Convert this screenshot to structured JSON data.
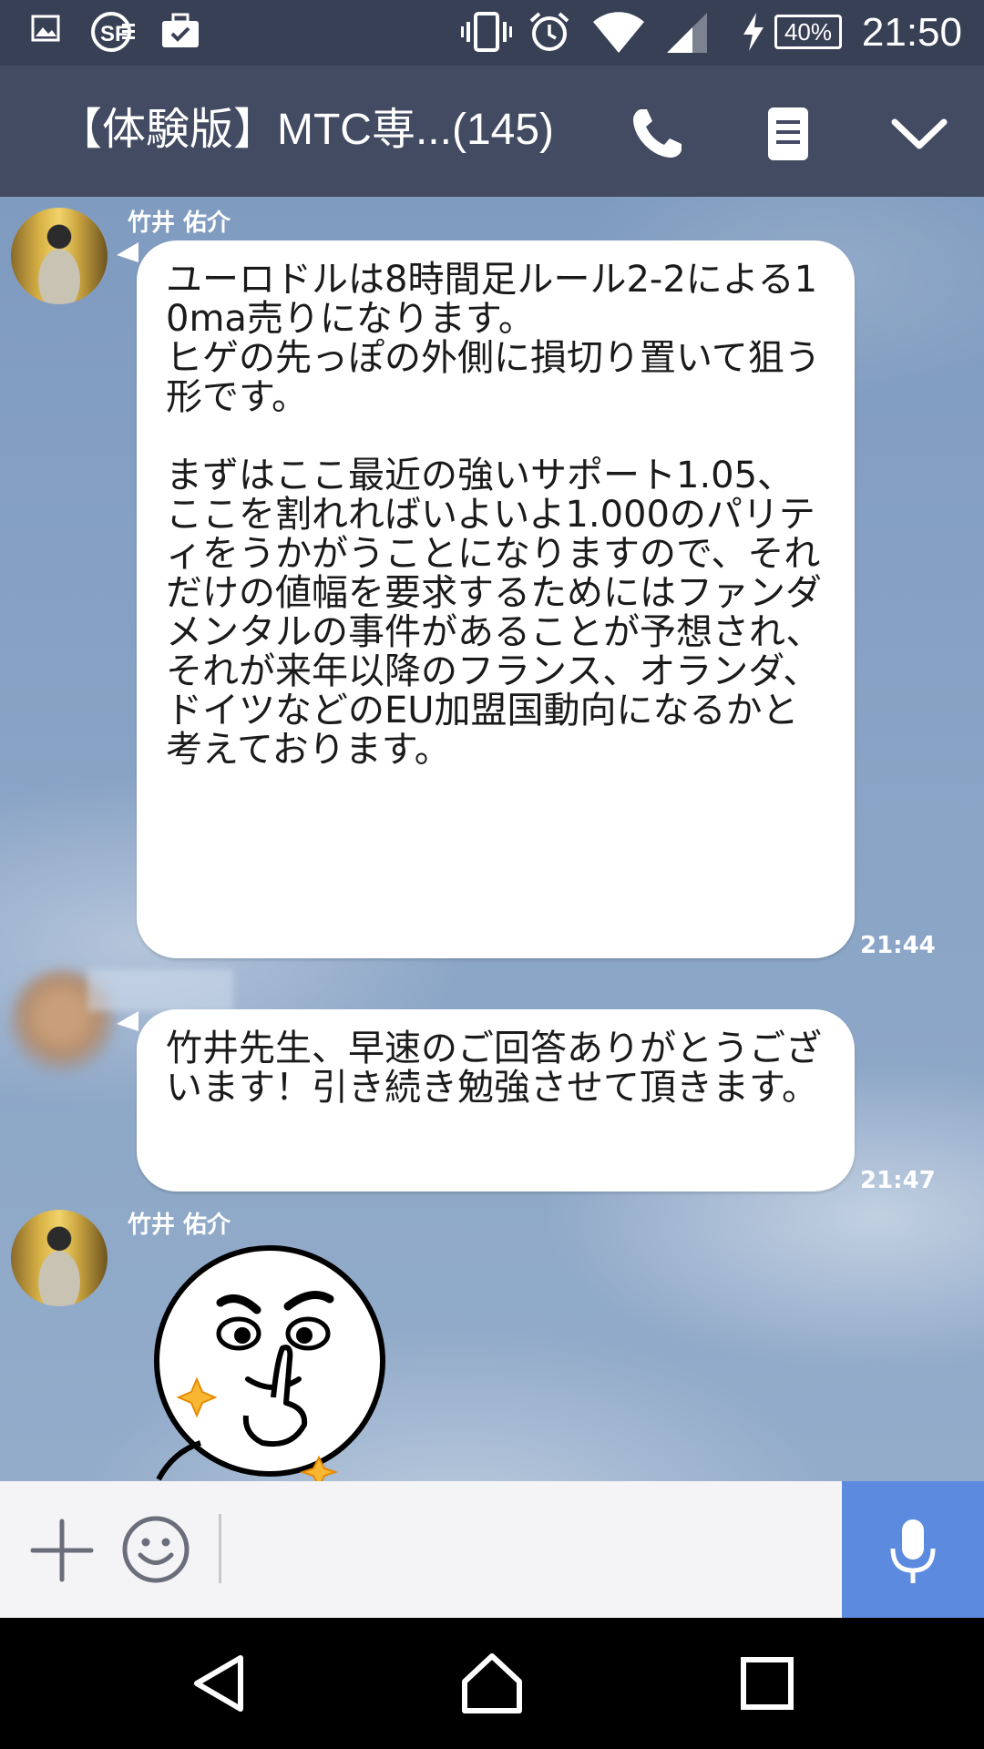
{
  "status_bar": {
    "time": "21:50",
    "battery": "40%",
    "icons": [
      "image-icon",
      "sf-app-icon",
      "briefcase-icon",
      "vibrate-icon",
      "alarm-icon",
      "wifi-icon",
      "signal-icon",
      "charging-icon",
      "battery-icon"
    ]
  },
  "header": {
    "title": "【体験版】MTC専...(145)",
    "icons": [
      "phone-icon",
      "note-icon",
      "chevron-down-icon"
    ]
  },
  "messages": [
    {
      "sender": "竹井 佑介",
      "text": "ユーロドルは8時間足ルール2-2による10ma売りになります。\nヒゲの先っぽの外側に損切り置いて狙う形です。\n\nまずはここ最近の強いサポート1.05、ここを割れればいよいよ1.000のパリティをうかがうことになりますので、それだけの値幅を要求するためにはファンダメンタルの事件があることが予想され、それが来年以降のフランス、オランダ、ドイツなどのEU加盟国動向になるかと考えております。",
      "time": "21:44"
    },
    {
      "sender": "",
      "text": "竹井先生、早速のご回答ありがとうございます！引き続き勉強させて頂きます。",
      "time": "21:47"
    },
    {
      "sender": "竹井 佑介",
      "type": "sticker"
    }
  ],
  "input_bar": {
    "icons": [
      "plus-icon",
      "emoji-icon",
      "microphone-icon"
    ]
  },
  "nav_bar": {
    "icons": [
      "back-icon",
      "home-icon",
      "recents-icon"
    ]
  },
  "colors": {
    "status_bar": "#384055",
    "header": "#434b62",
    "mic_button": "#5b8adf",
    "bubble": "#ffffff"
  }
}
